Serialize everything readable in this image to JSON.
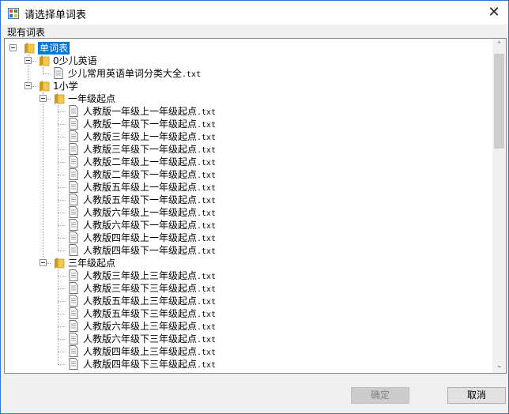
{
  "window": {
    "title": "请选择单词表",
    "close_glyph": "✕",
    "icon": "app-window-icon"
  },
  "section_label": "现有词表",
  "tree": {
    "root": "单词表",
    "nodes": [
      {
        "label": "单词表",
        "kind": "folder",
        "level": 0,
        "selected": true
      },
      {
        "label": "0少儿英语",
        "kind": "folder",
        "level": 1
      },
      {
        "label": "少儿常用英语单词分类大全",
        "ext": ".txt",
        "kind": "file",
        "level": 2
      },
      {
        "label": "1小学",
        "kind": "folder",
        "level": 1
      },
      {
        "label": "一年级起点",
        "kind": "folder",
        "level": 2
      },
      {
        "label": "人教版一年级上一年级起点",
        "ext": ".txt",
        "kind": "file",
        "level": 3
      },
      {
        "label": "人教版一年级下一年级起点",
        "ext": ".txt",
        "kind": "file",
        "level": 3
      },
      {
        "label": "人教版三年级上一年级起点",
        "ext": ".txt",
        "kind": "file",
        "level": 3
      },
      {
        "label": "人教版三年级下一年级起点",
        "ext": ".txt",
        "kind": "file",
        "level": 3
      },
      {
        "label": "人教版二年级上一年级起点",
        "ext": ".txt",
        "kind": "file",
        "level": 3
      },
      {
        "label": "人教版二年级下一年级起点",
        "ext": ".txt",
        "kind": "file",
        "level": 3
      },
      {
        "label": "人教版五年级上一年级起点",
        "ext": ".txt",
        "kind": "file",
        "level": 3
      },
      {
        "label": "人教版五年级下一年级起点",
        "ext": ".txt",
        "kind": "file",
        "level": 3
      },
      {
        "label": "人教版六年级上一年级起点",
        "ext": ".txt",
        "kind": "file",
        "level": 3
      },
      {
        "label": "人教版六年级下一年级起点",
        "ext": ".txt",
        "kind": "file",
        "level": 3
      },
      {
        "label": "人教版四年级上一年级起点",
        "ext": ".txt",
        "kind": "file",
        "level": 3
      },
      {
        "label": "人教版四年级下一年级起点",
        "ext": ".txt",
        "kind": "file",
        "level": 3
      },
      {
        "label": "三年级起点",
        "kind": "folder",
        "level": 2
      },
      {
        "label": "人教版三年级上三年级起点",
        "ext": ".txt",
        "kind": "file",
        "level": 3
      },
      {
        "label": "人教版三年级下三年级起点",
        "ext": ".txt",
        "kind": "file",
        "level": 3
      },
      {
        "label": "人教版五年级上三年级起点",
        "ext": ".txt",
        "kind": "file",
        "level": 3
      },
      {
        "label": "人教版五年级下三年级起点",
        "ext": ".txt",
        "kind": "file",
        "level": 3
      },
      {
        "label": "人教版六年级上三年级起点",
        "ext": ".txt",
        "kind": "file",
        "level": 3
      },
      {
        "label": "人教版六年级下三年级起点",
        "ext": ".txt",
        "kind": "file",
        "level": 3
      },
      {
        "label": "人教版四年级上三年级起点",
        "ext": ".txt",
        "kind": "file",
        "level": 3
      },
      {
        "label": "人教版四年级下三年级起点",
        "ext": ".txt",
        "kind": "file",
        "level": 3
      }
    ]
  },
  "scrollbar": {
    "up_glyph": "⌃",
    "down_glyph": "⌄"
  },
  "buttons": {
    "ok": "确定",
    "cancel": "取消"
  },
  "colors": {
    "selection": "#0078d7",
    "folder": "#f2c94c",
    "border": "#2b79d0"
  }
}
